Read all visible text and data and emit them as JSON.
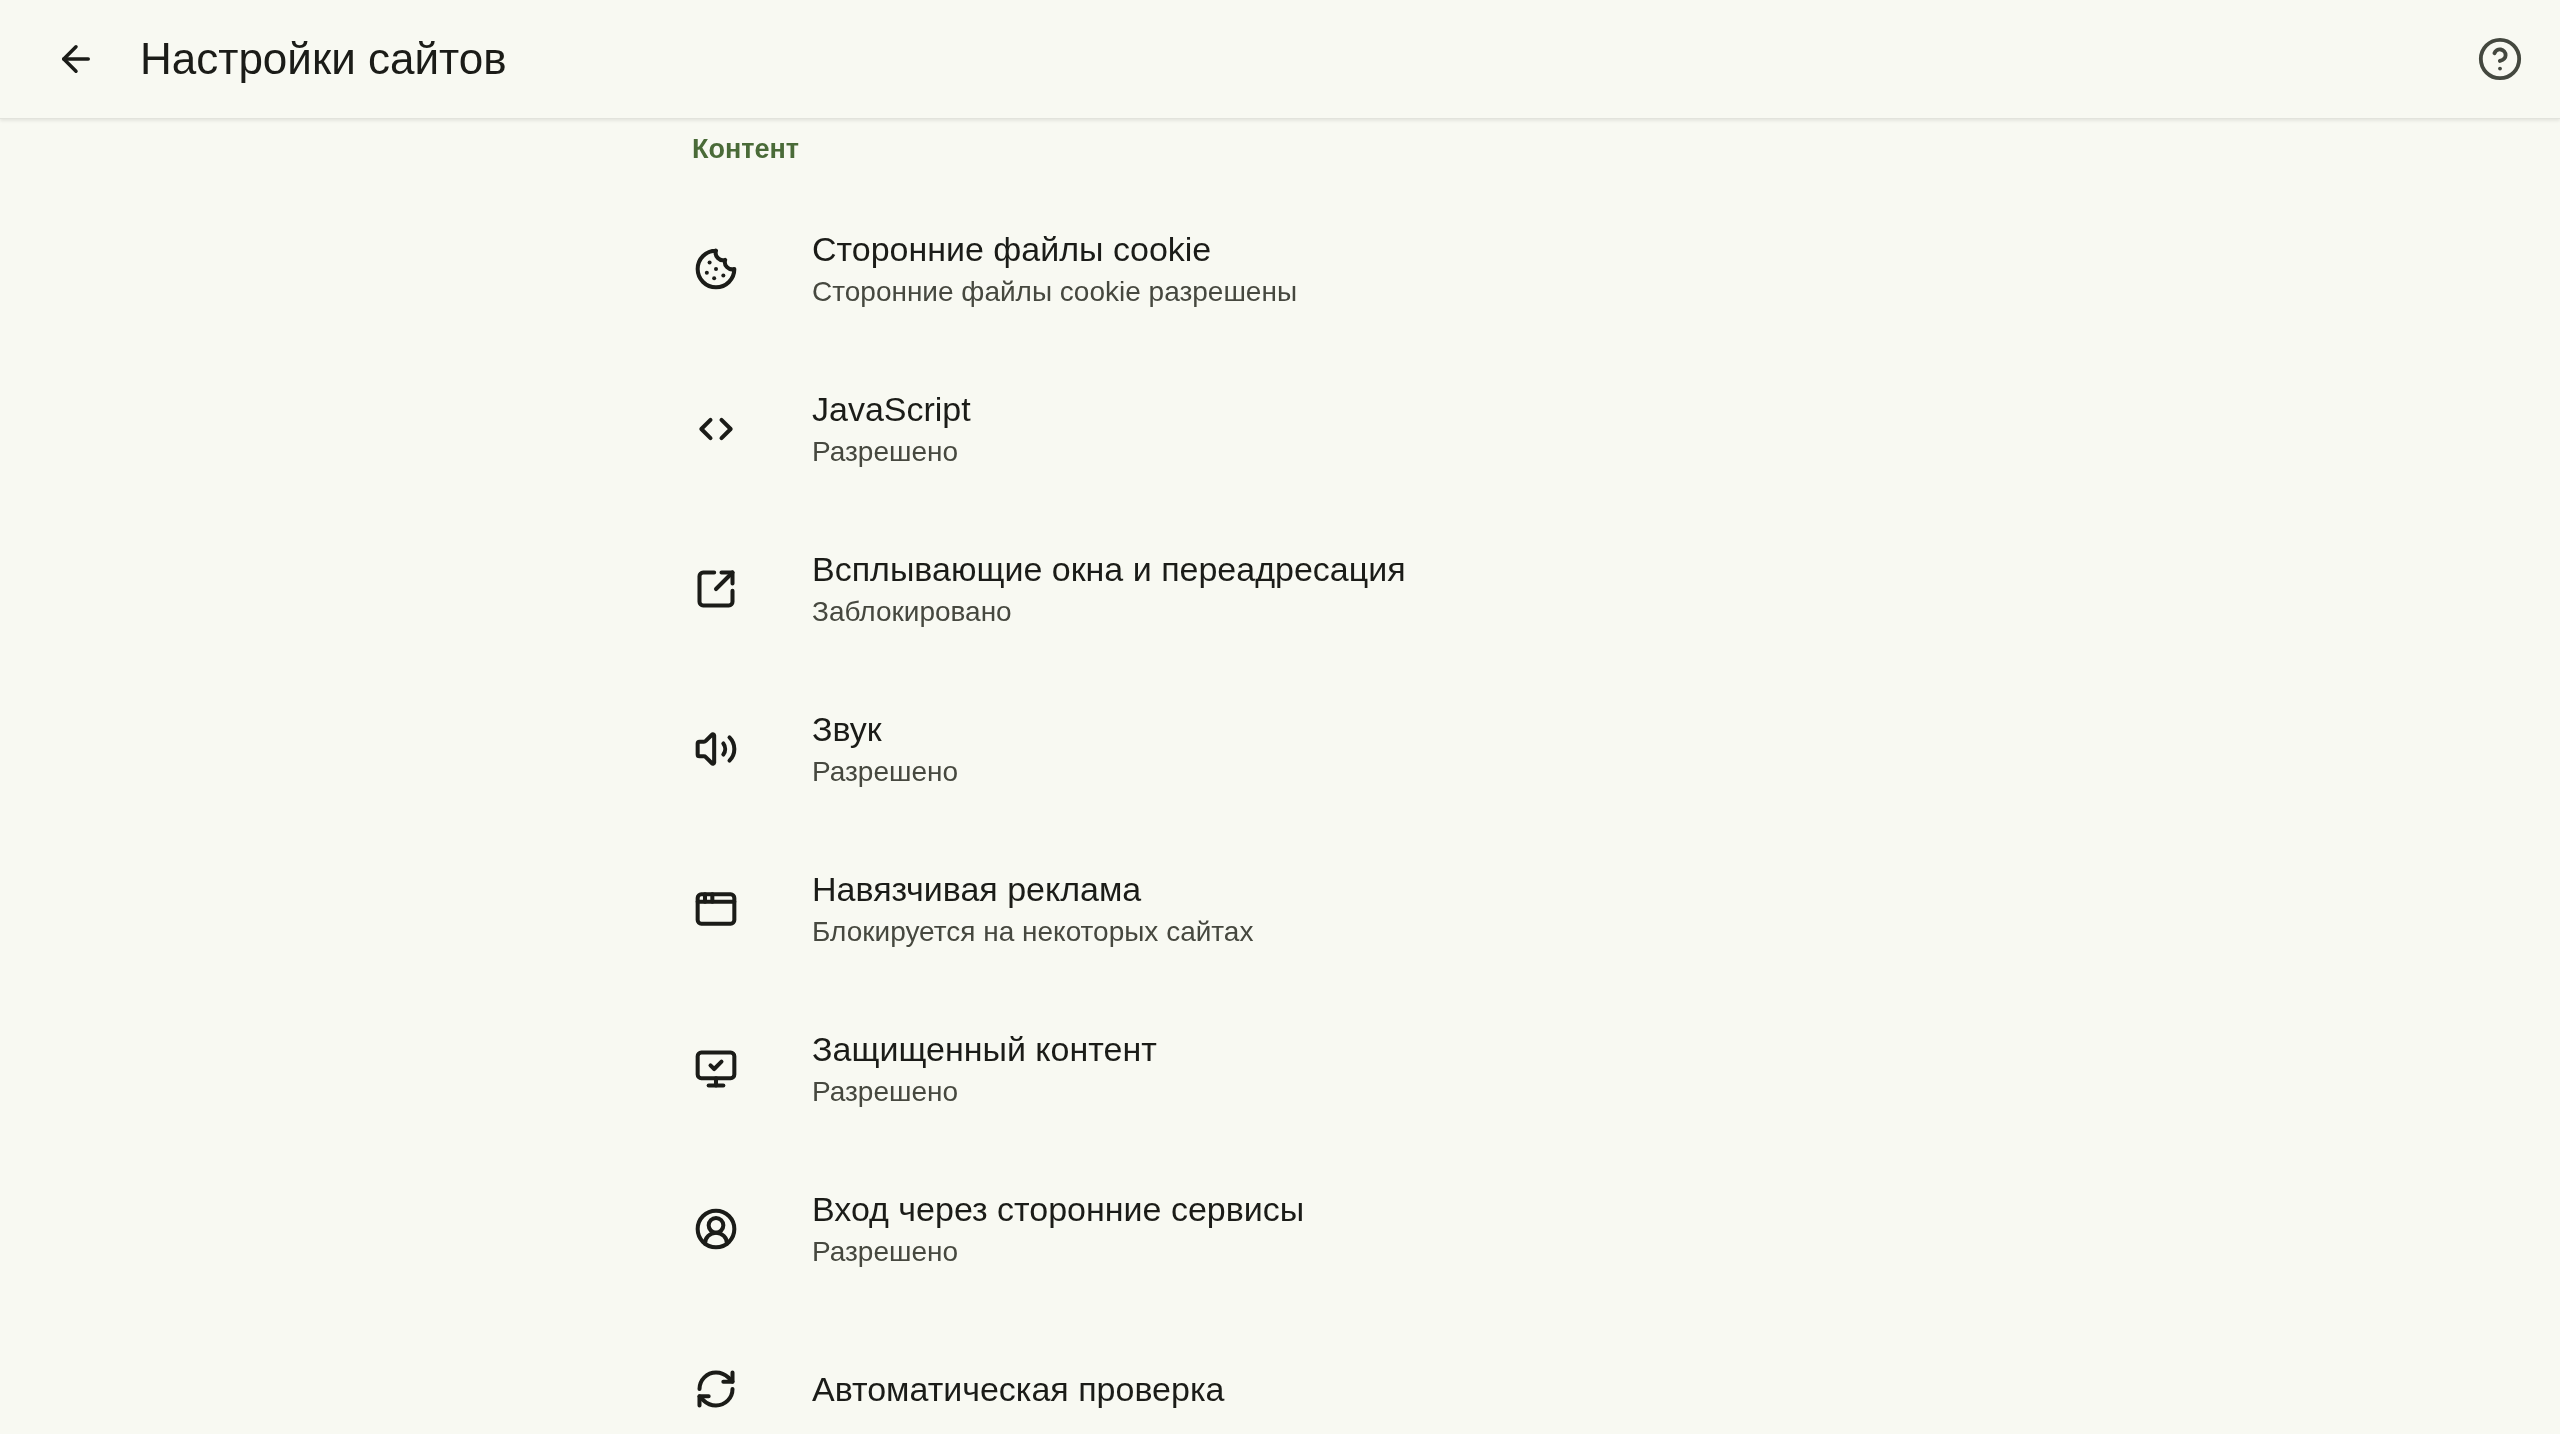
{
  "header": {
    "title": "Настройки сайтов"
  },
  "section": {
    "title": "Контент"
  },
  "items": [
    {
      "kind": "cookie",
      "title": "Сторонние файлы cookie",
      "subtitle": "Сторонние файлы cookie разрешены"
    },
    {
      "kind": "code",
      "title": "JavaScript",
      "subtitle": "Разрешено"
    },
    {
      "kind": "popup",
      "title": "Всплывающие окна и переадресация",
      "subtitle": "Заблокировано"
    },
    {
      "kind": "sound",
      "title": "Звук",
      "subtitle": "Разрешено"
    },
    {
      "kind": "ads",
      "title": "Навязчивая реклама",
      "subtitle": "Блокируется на некоторых сайтах"
    },
    {
      "kind": "protected",
      "title": "Защищенный контент",
      "subtitle": "Разрешено"
    },
    {
      "kind": "signin",
      "title": "Вход через сторонние сервисы",
      "subtitle": "Разрешено"
    },
    {
      "kind": "sync",
      "title": "Автоматическая проверка"
    }
  ]
}
